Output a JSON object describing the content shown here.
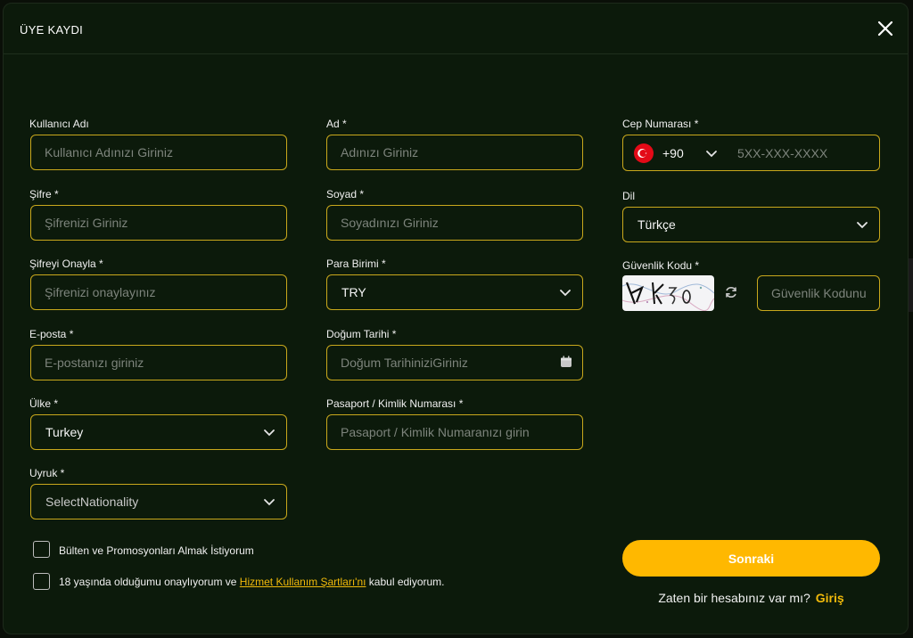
{
  "modal": {
    "title": "ÜYE KAYDI"
  },
  "fields": {
    "username": {
      "label": "Kullanıcı Adı",
      "placeholder": "Kullanıcı Adınızı Giriniz"
    },
    "password": {
      "label": "Şifre *",
      "placeholder": "Şifrenizi Giriniz"
    },
    "password_confirm": {
      "label": "Şifreyi Onayla *",
      "placeholder": "Şifrenizi onaylayınız"
    },
    "email": {
      "label": "E-posta *",
      "placeholder": "E-postanızı giriniz"
    },
    "country": {
      "label": "Ülke *",
      "value": "Turkey"
    },
    "nationality": {
      "label": "Uyruk *",
      "value": "SelectNationality"
    },
    "first_name": {
      "label": "Ad *",
      "placeholder": "Adınızı Giriniz"
    },
    "last_name": {
      "label": "Soyad *",
      "placeholder": "Soyadınızı Giriniz"
    },
    "currency": {
      "label": "Para Birimi *",
      "value": "TRY"
    },
    "birth_date": {
      "label": "Doğum Tarihi *",
      "placeholder": "Doğum TarihiniziGiriniz"
    },
    "passport": {
      "label": "Pasaport / Kimlik Numarası *",
      "placeholder": "Pasaport / Kimlik Numaranızı girin"
    },
    "phone": {
      "label": "Cep Numarası *",
      "country_code": "+90",
      "placeholder": "5XX-XXX-XXXX",
      "flag": "turkey-flag-icon"
    },
    "language": {
      "label": "Dil",
      "value": "Türkçe"
    },
    "captcha": {
      "label": "Güvenlik Kodu *",
      "placeholder": "Güvenlik Kodunu Giriniz"
    }
  },
  "checks": {
    "newsletter": "Bülten ve Promosyonları Almak İstiyorum",
    "age_prefix": "18 yaşında olduğumu onaylıyorum ve ",
    "age_link": "Hizmet Kullanım Şartları'nı",
    "age_suffix": " kabul ediyorum."
  },
  "actions": {
    "next": "Sonraki",
    "login_prompt": "Zaten bir hesabınız var mı?",
    "login_link": "Giriş"
  },
  "colors": {
    "accent": "#ffb800",
    "border": "#c9a81c",
    "background": "#0c1a0b",
    "link": "#f0b90b"
  }
}
